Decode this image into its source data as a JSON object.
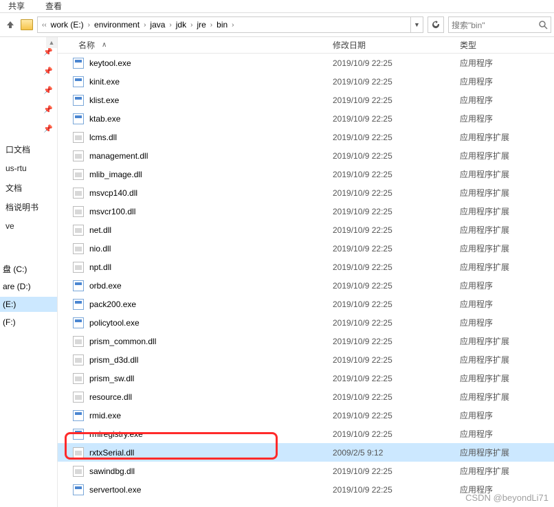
{
  "ribbon": {
    "share": "共享",
    "view": "查看"
  },
  "breadcrumbs": [
    "work (E:)",
    "environment",
    "java",
    "jdk",
    "jre",
    "bin"
  ],
  "search": {
    "placeholder": "搜索\"bin\""
  },
  "columns": {
    "name": "名称",
    "date": "修改日期",
    "type": "类型"
  },
  "sidebar": {
    "pinned": [
      "",
      "",
      "",
      "",
      ""
    ],
    "items": [
      "口文档",
      "us-rtu",
      "文档",
      "档说明书",
      "ve"
    ],
    "drives": [
      "盘 (C:)",
      "are (D:)",
      "(E:)",
      "(F:)"
    ],
    "selected_drive": "(E:)"
  },
  "type_labels": {
    "app": "应用程序",
    "ext": "应用程序扩展"
  },
  "files": [
    {
      "name": "keytool.exe",
      "date": "2019/10/9 22:25",
      "kind": "exe"
    },
    {
      "name": "kinit.exe",
      "date": "2019/10/9 22:25",
      "kind": "exe"
    },
    {
      "name": "klist.exe",
      "date": "2019/10/9 22:25",
      "kind": "exe"
    },
    {
      "name": "ktab.exe",
      "date": "2019/10/9 22:25",
      "kind": "exe"
    },
    {
      "name": "lcms.dll",
      "date": "2019/10/9 22:25",
      "kind": "dll"
    },
    {
      "name": "management.dll",
      "date": "2019/10/9 22:25",
      "kind": "dll"
    },
    {
      "name": "mlib_image.dll",
      "date": "2019/10/9 22:25",
      "kind": "dll"
    },
    {
      "name": "msvcp140.dll",
      "date": "2019/10/9 22:25",
      "kind": "dll"
    },
    {
      "name": "msvcr100.dll",
      "date": "2019/10/9 22:25",
      "kind": "dll"
    },
    {
      "name": "net.dll",
      "date": "2019/10/9 22:25",
      "kind": "dll"
    },
    {
      "name": "nio.dll",
      "date": "2019/10/9 22:25",
      "kind": "dll"
    },
    {
      "name": "npt.dll",
      "date": "2019/10/9 22:25",
      "kind": "dll"
    },
    {
      "name": "orbd.exe",
      "date": "2019/10/9 22:25",
      "kind": "exe"
    },
    {
      "name": "pack200.exe",
      "date": "2019/10/9 22:25",
      "kind": "exe"
    },
    {
      "name": "policytool.exe",
      "date": "2019/10/9 22:25",
      "kind": "exe"
    },
    {
      "name": "prism_common.dll",
      "date": "2019/10/9 22:25",
      "kind": "dll"
    },
    {
      "name": "prism_d3d.dll",
      "date": "2019/10/9 22:25",
      "kind": "dll"
    },
    {
      "name": "prism_sw.dll",
      "date": "2019/10/9 22:25",
      "kind": "dll"
    },
    {
      "name": "resource.dll",
      "date": "2019/10/9 22:25",
      "kind": "dll"
    },
    {
      "name": "rmid.exe",
      "date": "2019/10/9 22:25",
      "kind": "exe"
    },
    {
      "name": "rmiregistry.exe",
      "date": "2019/10/9 22:25",
      "kind": "exe"
    },
    {
      "name": "rxtxSerial.dll",
      "date": "2009/2/5 9:12",
      "kind": "dll",
      "selected": true
    },
    {
      "name": "sawindbg.dll",
      "date": "2019/10/9 22:25",
      "kind": "dll"
    },
    {
      "name": "servertool.exe",
      "date": "2019/10/9 22:25",
      "kind": "exe"
    }
  ],
  "highlight_file": "rxtxSerial.dll",
  "watermark": "CSDN @beyondLi71"
}
